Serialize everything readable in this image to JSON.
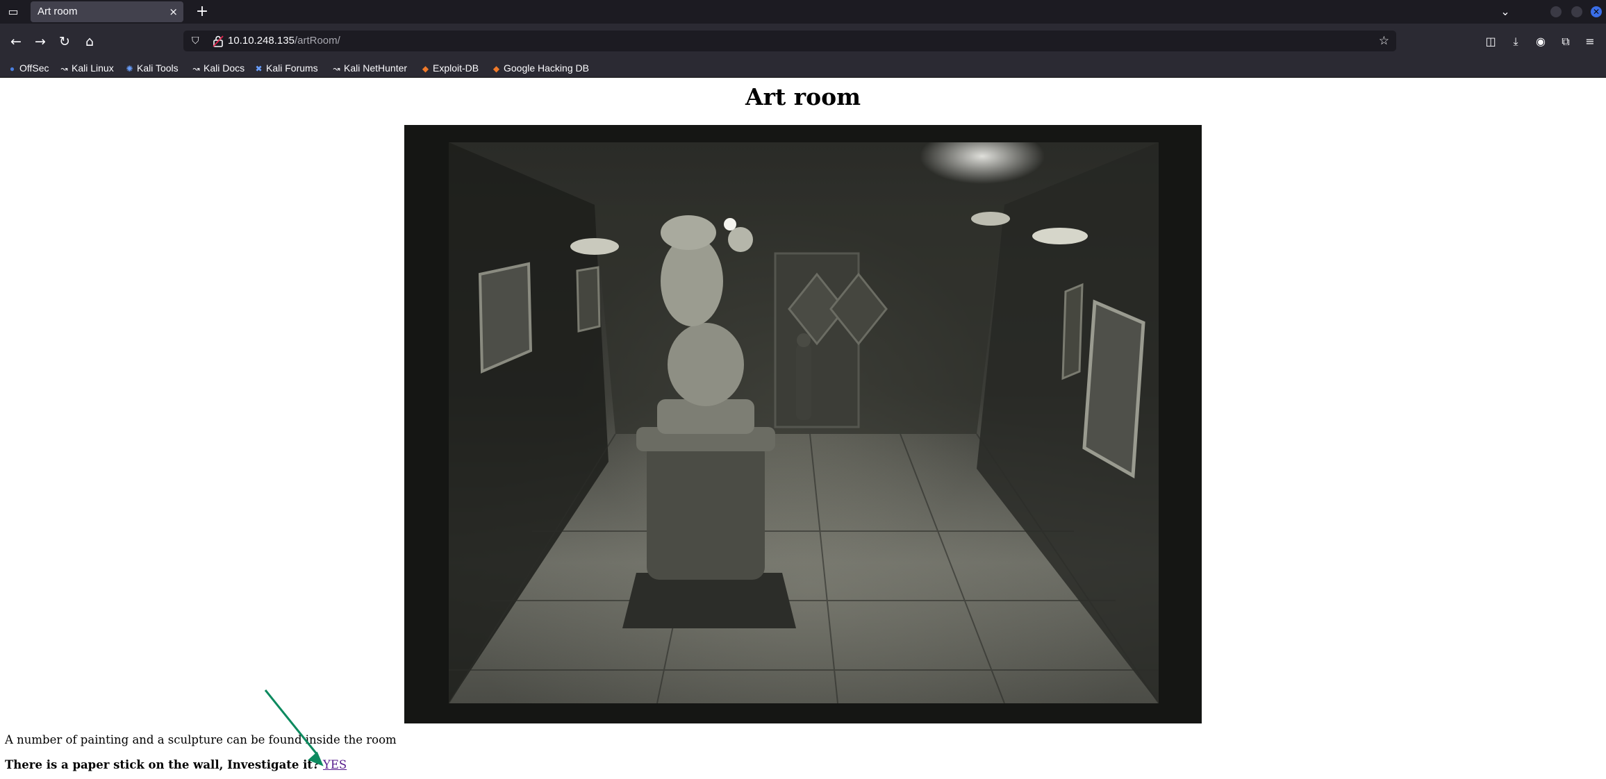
{
  "browser": {
    "tab": {
      "title": "Art room",
      "close_icon": "×"
    },
    "new_tab_icon": "+",
    "url": {
      "host": "10.10.248.135",
      "path": "/artRoom/"
    },
    "bookmarks": [
      {
        "label": "OffSec",
        "icon": "offsec-icon"
      },
      {
        "label": "Kali Linux",
        "icon": "kali-dragon-icon"
      },
      {
        "label": "Kali Tools",
        "icon": "kali-tools-icon"
      },
      {
        "label": "Kali Docs",
        "icon": "kali-dragon-icon"
      },
      {
        "label": "Kali Forums",
        "icon": "kali-forums-icon"
      },
      {
        "label": "Kali NetHunter",
        "icon": "kali-dragon-icon"
      },
      {
        "label": "Exploit-DB",
        "icon": "exploit-db-icon"
      },
      {
        "label": "Google Hacking DB",
        "icon": "exploit-db-icon"
      }
    ],
    "colors": {
      "tabstrip": "#1c1b22",
      "toolbar": "#2b2a33",
      "active_tab": "#42414d",
      "close_button": "#3a6ee8"
    }
  },
  "page": {
    "title": "Art room",
    "image_description_icon": "art-room-photo",
    "description": "A number of painting and a sculpture can be found inside the room",
    "question": "There is a paper stick on the wall, Investigate it?",
    "link_label": "YES",
    "annotation_arrow_color": "#0d8a5f"
  }
}
